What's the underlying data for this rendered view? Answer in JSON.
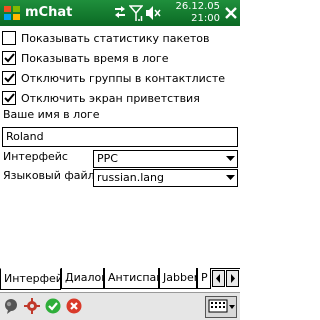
{
  "titlebar": {
    "app_title": "mChat",
    "date": "26.12.05",
    "time": "21:00",
    "icons": [
      "windows-flag-icon",
      "connectivity-icon",
      "signal-icon",
      "volume-icon",
      "close-icon"
    ]
  },
  "options": {
    "checkboxes": [
      {
        "label": "Показывать статистику пакетов",
        "checked": false
      },
      {
        "label": "Показывать время в логе",
        "checked": true
      },
      {
        "label": "Отключить группы в контактлисте",
        "checked": true
      },
      {
        "label": "Отключить экран приветствия",
        "checked": true
      }
    ],
    "name_label": "Ваше имя в логе",
    "name_value": "Roland",
    "interface_label": "Интерфейс",
    "interface_value": "PPC",
    "language_label": "Языковый файл",
    "language_value": "russian.lang"
  },
  "tabs": [
    {
      "label": "Интерфейс",
      "active": true
    },
    {
      "label": "Диалог",
      "active": false
    },
    {
      "label": "Антиспам",
      "active": false
    },
    {
      "label": "Jabber",
      "active": false
    },
    {
      "label": "P",
      "active": false
    }
  ],
  "bottombar": {
    "icons": [
      "status-icon",
      "settings-icon",
      "ok-icon",
      "cancel-icon",
      "keyboard-icon"
    ]
  },
  "colors": {
    "titlebar": "#11772e",
    "ok": "#2fae3a",
    "cancel": "#d93a2a"
  }
}
